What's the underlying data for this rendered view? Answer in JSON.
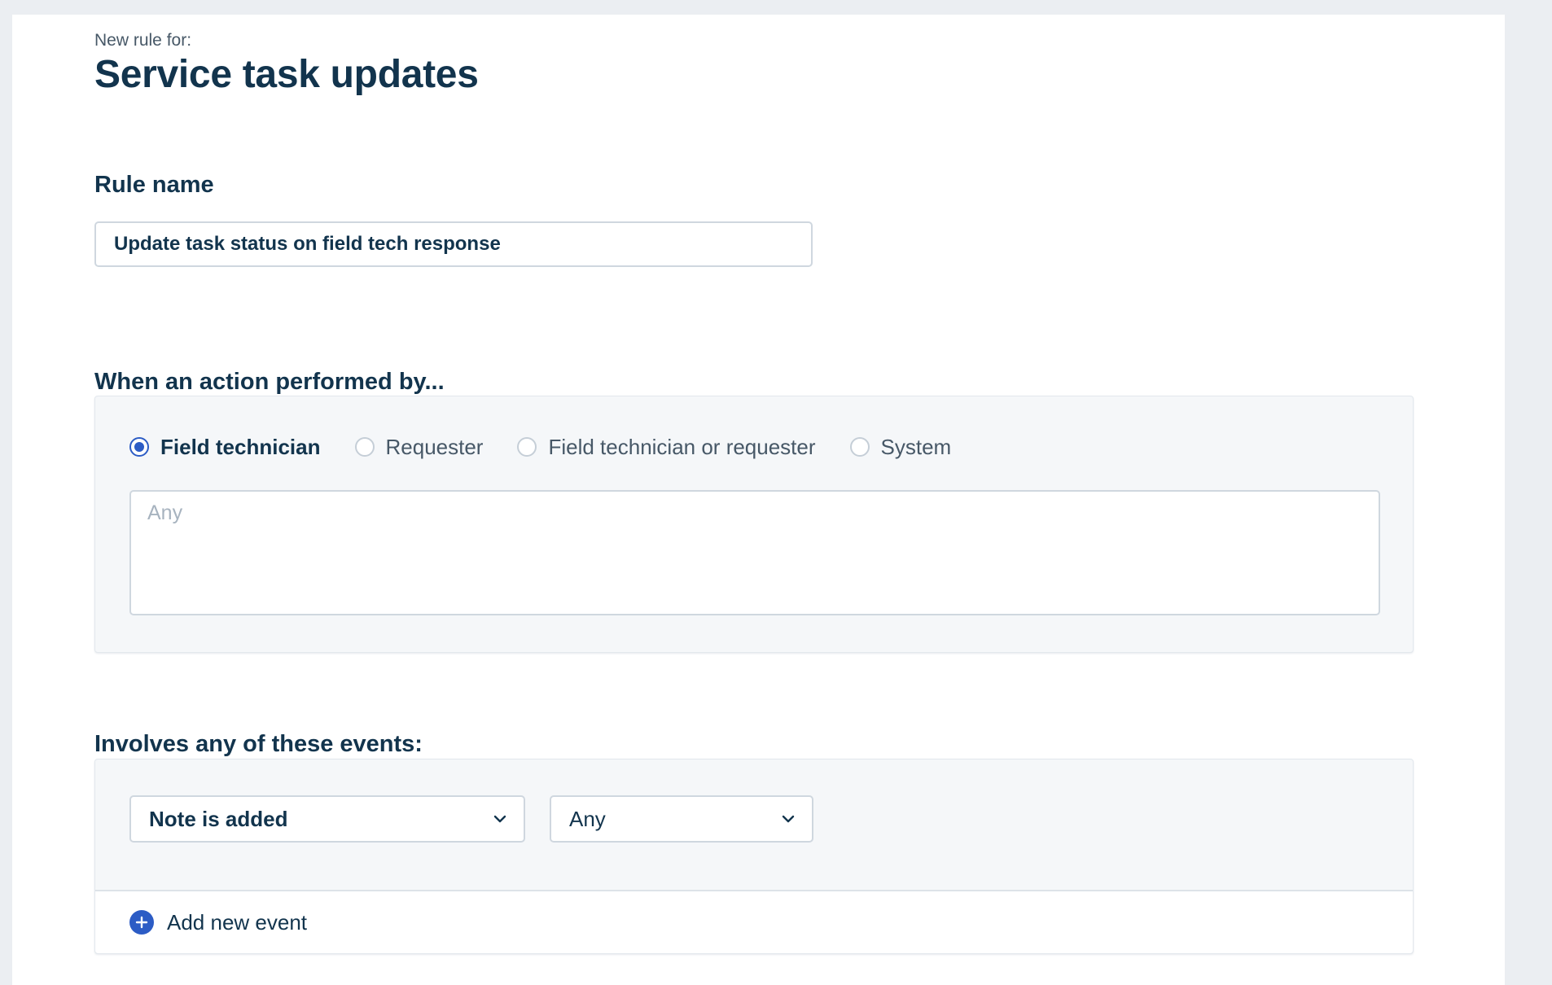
{
  "header": {
    "subtitle": "New rule for:",
    "title": "Service task updates"
  },
  "rule_name": {
    "label": "Rule name",
    "value": "Update task status on field tech response"
  },
  "actor": {
    "label": "When an action performed by...",
    "options": [
      {
        "label": "Field technician",
        "checked": true
      },
      {
        "label": "Requester",
        "checked": false
      },
      {
        "label": "Field technician or requester",
        "checked": false
      },
      {
        "label": "System",
        "checked": false
      }
    ],
    "filter_placeholder": "Any"
  },
  "events": {
    "label": "Involves any of these events:",
    "event_select": "Note is added",
    "qualifier_select": "Any",
    "add_label": "Add new event"
  },
  "colors": {
    "accent": "#2c5cc5",
    "text": "#12344d",
    "panel_bg": "#f5f7f9",
    "page_bg": "#ebeef2"
  },
  "icons": {
    "dropdown": "chevron-down-icon",
    "add": "plus-circle-icon"
  }
}
